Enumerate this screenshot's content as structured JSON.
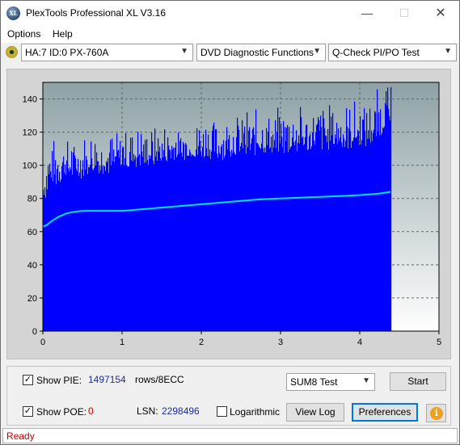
{
  "window": {
    "title": "PlexTools Professional XL V3.16",
    "icon_text": "XL",
    "controls": {
      "minimize": "—",
      "maximize": "☐",
      "close": "✕"
    }
  },
  "menu": {
    "options": "Options",
    "help": "Help"
  },
  "toolbar": {
    "drive": "HA:7 ID:0  PX-760A",
    "function": "DVD Diagnostic Functions",
    "test": "Q-Check PI/PO Test"
  },
  "chart_data": {
    "type": "bar",
    "title": "",
    "xlabel": "",
    "ylabel": "",
    "xlim": [
      0,
      5
    ],
    "ylim": [
      0,
      150
    ],
    "x_ticks": [
      "0",
      "1",
      "2",
      "3",
      "4",
      "5"
    ],
    "y_ticks": [
      "0",
      "20",
      "40",
      "60",
      "80",
      "100",
      "120",
      "140"
    ],
    "grid": true,
    "data_end_x": 4.39,
    "series": [
      {
        "kind": "bar",
        "color": "#0000ff",
        "x": [
          0.0,
          0.05,
          0.1,
          0.2,
          0.3,
          0.5,
          0.75,
          1.0,
          1.25,
          1.5,
          1.75,
          2.0,
          2.25,
          2.5,
          2.75,
          3.0,
          3.25,
          3.5,
          3.75,
          4.0,
          4.1,
          4.2,
          4.3,
          4.39
        ],
        "values": [
          82,
          88,
          92,
          95,
          97,
          98,
          100,
          102,
          104,
          105,
          107,
          108,
          109,
          110,
          111,
          112,
          113,
          114,
          115,
          116,
          117,
          119,
          125,
          130
        ],
        "peaks": [
          110,
          114,
          117,
          120,
          118,
          121,
          123,
          124,
          125,
          129,
          126,
          133,
          128,
          134,
          135,
          136,
          137,
          139,
          138,
          141,
          143,
          146,
          150,
          150
        ]
      },
      {
        "kind": "line",
        "color": "#00e0ff",
        "x": [
          0.0,
          0.05,
          0.1,
          0.2,
          0.3,
          0.4,
          0.5,
          0.75,
          1.0,
          1.25,
          1.5,
          1.75,
          2.0,
          2.25,
          2.5,
          2.75,
          3.0,
          3.25,
          3.5,
          3.75,
          4.0,
          4.25,
          4.39
        ],
        "values": [
          63,
          64,
          66,
          69,
          71,
          72,
          72.5,
          72.5,
          72.5,
          73.5,
          74.5,
          75.5,
          76.5,
          77.5,
          78.5,
          79.5,
          80,
          80.5,
          81,
          81.5,
          82,
          83,
          84
        ]
      }
    ]
  },
  "controls": {
    "show_pie_label": "Show PIE:",
    "pie_value": "1497154",
    "pie_unit": "rows/8ECC",
    "show_poe_label": "Show POE:",
    "poe_value": "0",
    "lsn_label": "LSN:",
    "lsn_value": "2298496",
    "logarithmic_label": "Logarithmic",
    "sum_test": "SUM8 Test",
    "start": "Start",
    "view_log": "View Log",
    "preferences": "Preferences",
    "info_icon_text": "i",
    "checked_mark": "✓"
  },
  "status": {
    "text": "Ready"
  }
}
